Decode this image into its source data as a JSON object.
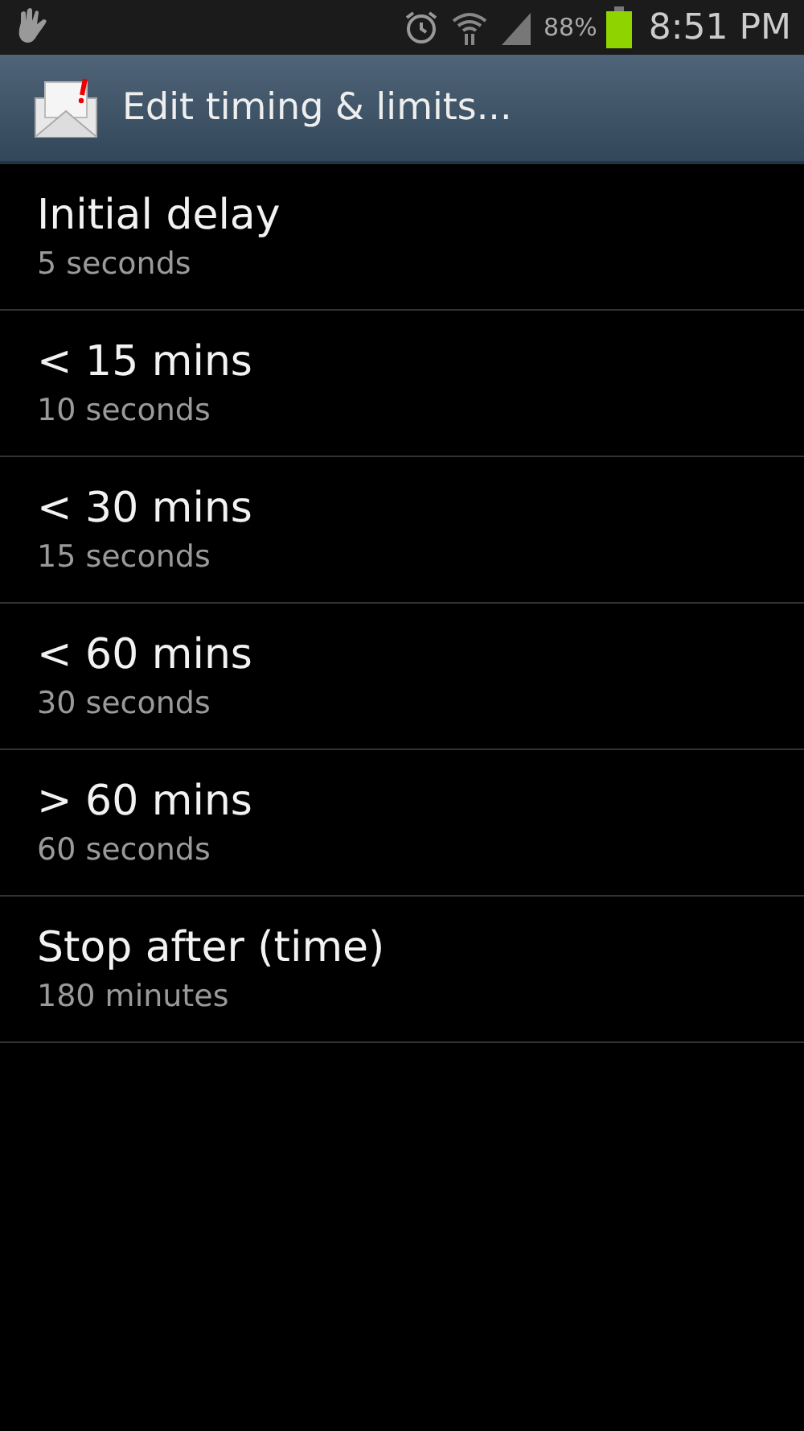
{
  "status_bar": {
    "battery": "88%",
    "time": "8:51 PM"
  },
  "action_bar": {
    "title": "Edit timing & limits..."
  },
  "settings": [
    {
      "title": "Initial delay",
      "summary": "5 seconds"
    },
    {
      "title": "< 15 mins",
      "summary": "10 seconds"
    },
    {
      "title": "< 30 mins",
      "summary": "15 seconds"
    },
    {
      "title": "< 60 mins",
      "summary": "30 seconds"
    },
    {
      "title": "> 60 mins",
      "summary": "60 seconds"
    },
    {
      "title": "Stop after (time)",
      "summary": "180 minutes"
    }
  ]
}
